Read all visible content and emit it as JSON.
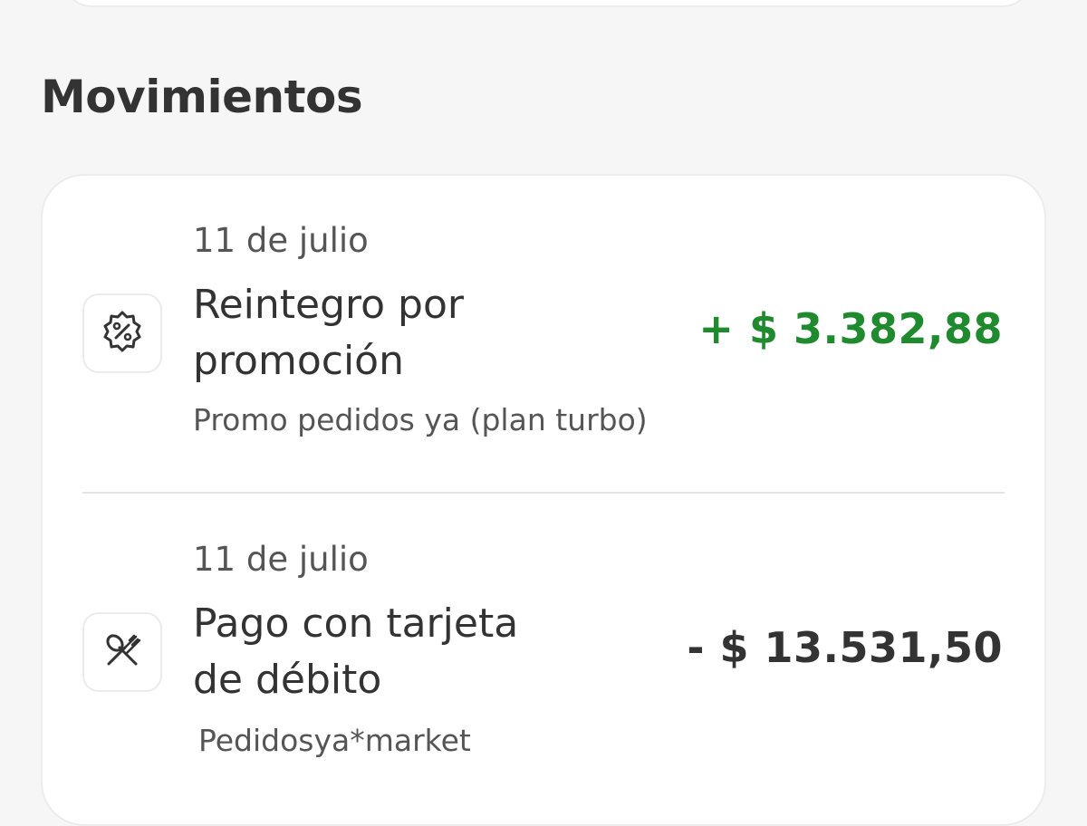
{
  "section": {
    "title": "Movimientos"
  },
  "movements": [
    {
      "date": "11 de julio",
      "title": "Reintegro por promoción",
      "description": "Promo pedidos ya (plan turbo)",
      "amount": "+ $ 3.382,88",
      "amount_color": "#1f8a2e",
      "icon": "discount-badge-icon"
    },
    {
      "date": "11 de julio",
      "title": "Pago con tarjeta de débito",
      "description": "Pedidosya*market",
      "amount": "- $ 13.531,50",
      "amount_color": "#333333",
      "icon": "fork-spoon-icon"
    }
  ]
}
